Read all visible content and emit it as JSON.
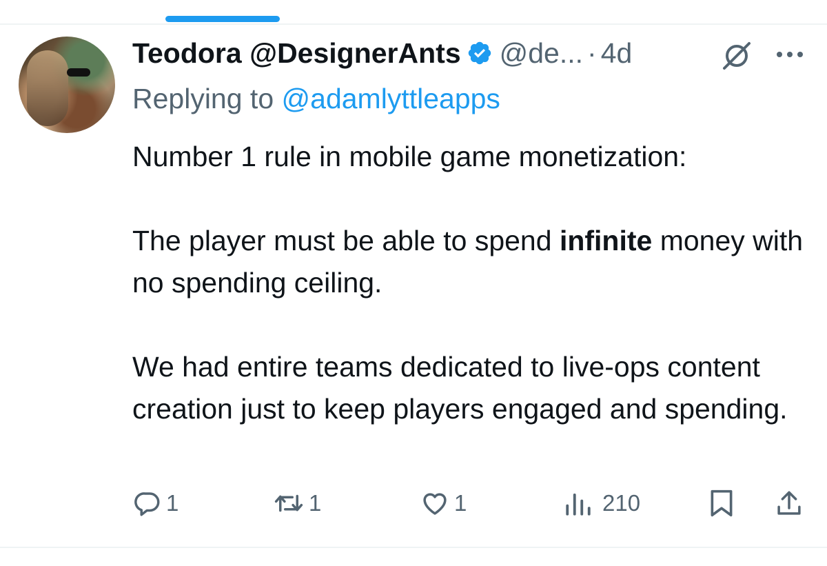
{
  "tweet": {
    "author": {
      "display_name": "Teodora @DesignerAnts",
      "handle": "@de...",
      "verified": true
    },
    "separator": "·",
    "timestamp": "4d",
    "replying_prefix": "Replying to",
    "replying_to": "@adamlyttleapps",
    "body": {
      "line1": "Number 1 rule in mobile game monetization:",
      "p2_before": "The player must be able to spend ",
      "p2_bold": "infinite",
      "p2_after": " money with no spending ceiling.",
      "p3": "We had entire teams dedicated to live-ops content creation just to keep players engaged and spending."
    },
    "actions": {
      "replies": "1",
      "reposts": "1",
      "likes": "1",
      "views": "210"
    }
  },
  "icons": [
    "verified-badge-icon",
    "grok-icon",
    "more-icon",
    "reply-icon",
    "repost-icon",
    "like-icon",
    "views-icon",
    "bookmark-icon",
    "share-icon"
  ],
  "colors": {
    "accent": "#1d9bf0",
    "text_primary": "#0f1419",
    "text_secondary": "#536471"
  }
}
